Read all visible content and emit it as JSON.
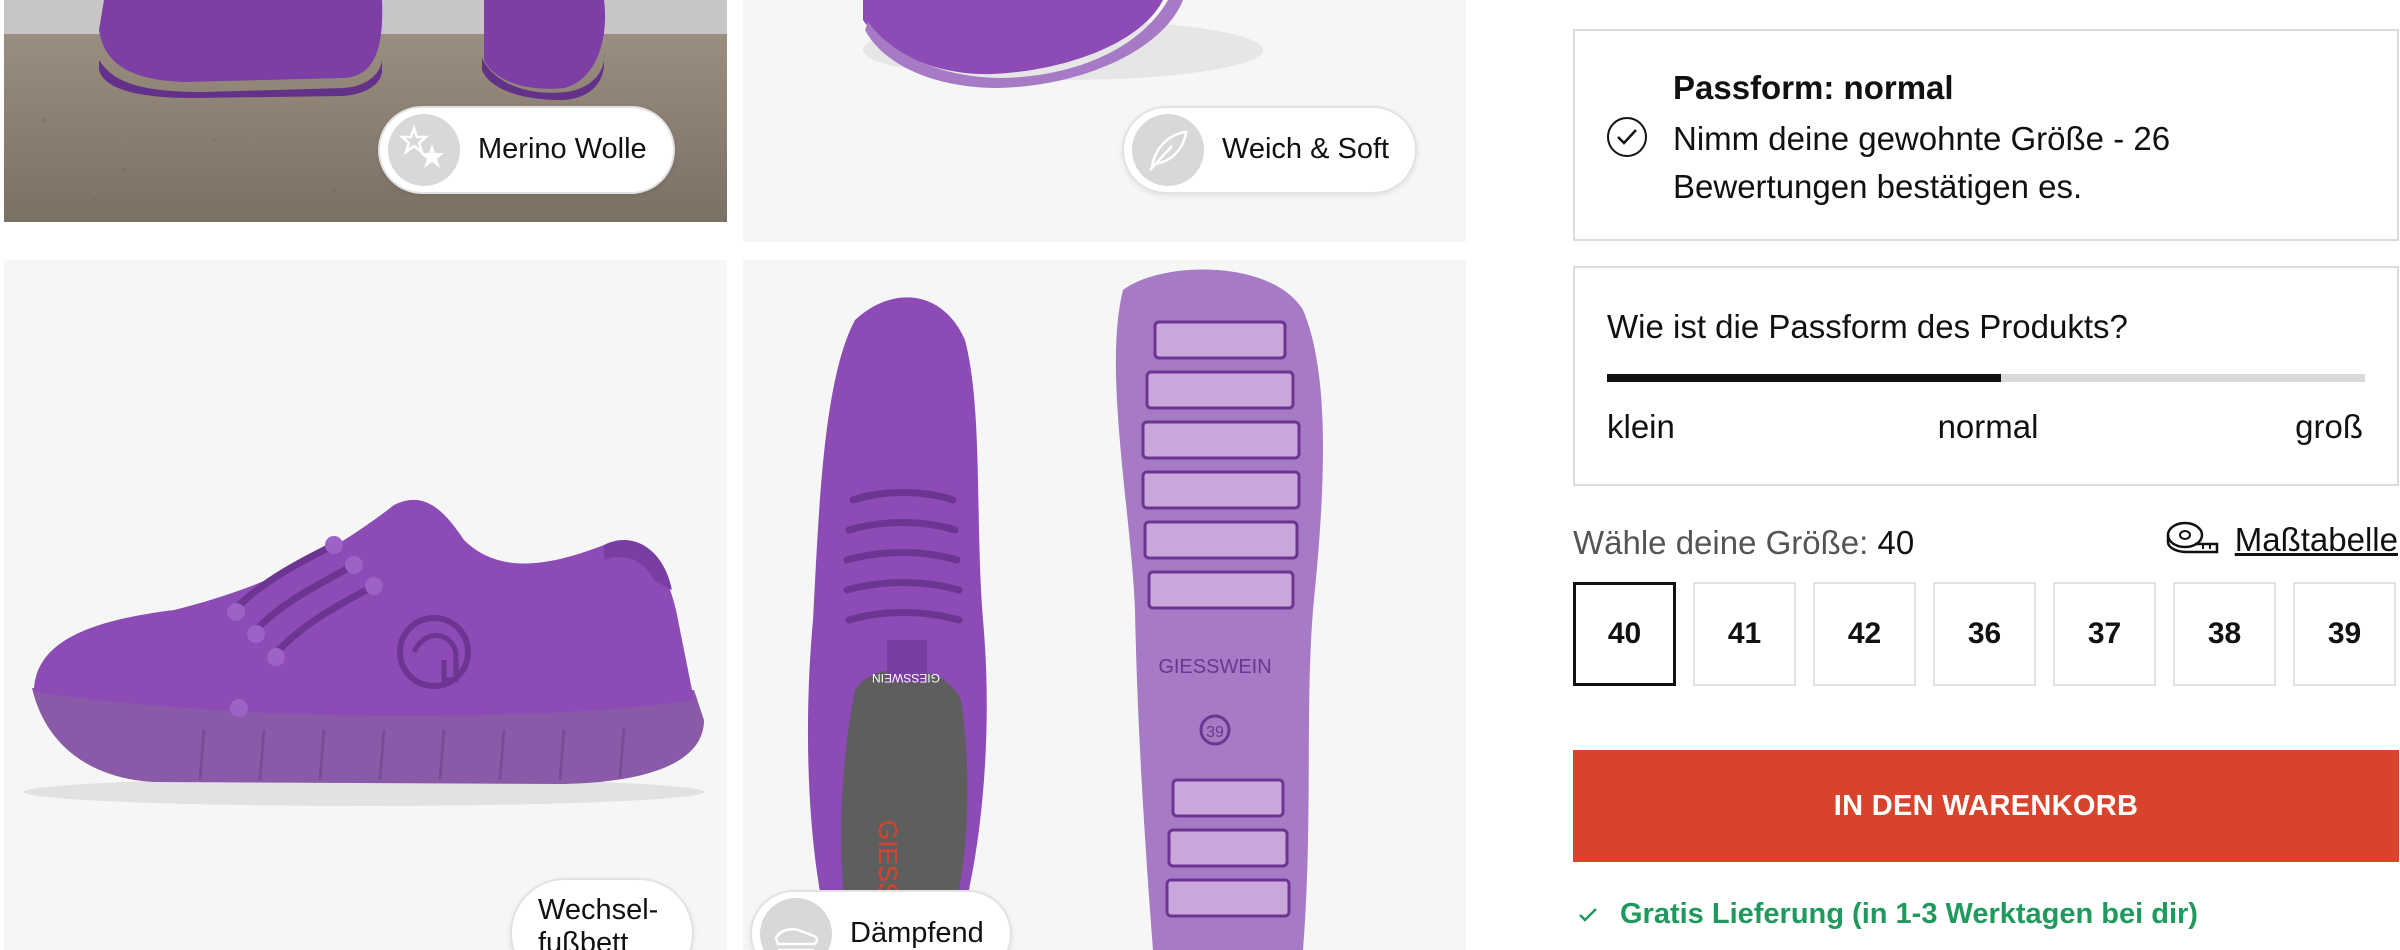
{
  "gallery": {
    "badges": {
      "merino": "Merino Wolle",
      "soft": "Weich & Soft",
      "footbed": "Wechsel-fußbett",
      "cushion": "Dämpfend"
    },
    "sole_brand": "GIESSWEIN",
    "sole_size": "39",
    "tongue_brand": "GIESSWEIN"
  },
  "fit": {
    "title": "Passform: normal",
    "text": "Nimm deine gewohnte Größe - 26 Bewertungen bestätigen es."
  },
  "survey": {
    "question": "Wie ist die Passform des Produkts?",
    "fill_fraction": 0.52,
    "labels": {
      "small": "klein",
      "normal": "normal",
      "large": "groß"
    }
  },
  "size": {
    "label": "Wähle deine Größe:",
    "selected": "40",
    "table_link": "Maßtabelle",
    "options": [
      "40",
      "41",
      "42",
      "36",
      "37",
      "38",
      "39"
    ]
  },
  "cart": {
    "button": "IN DEN WARENKORB"
  },
  "delivery": {
    "text": "Gratis Lieferung (in 1-3 Werktagen bei dir)"
  },
  "colors": {
    "accent": "#d8432b",
    "success": "#1f9a5c",
    "product": "#8c4bb5"
  }
}
